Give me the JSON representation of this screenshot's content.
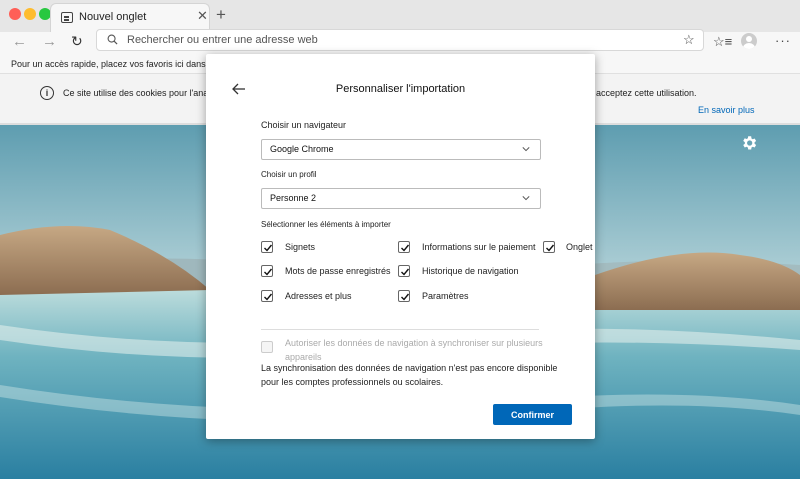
{
  "browser": {
    "tab_title": "Nouvel onglet",
    "address_placeholder": "Rechercher ou entrer une adresse web",
    "favorites_bar_text": "Pour un accès rapide, placez vos favoris ici dans la barre",
    "cookie_text_left": "Ce site utilise des cookies pour l'analy",
    "cookie_text_right": "acceptez cette utilisation.",
    "learn_more": "En savoir plus"
  },
  "dialog": {
    "title": "Personnaliser l'importation",
    "browser_label": "Choisir un navigateur",
    "browser_value": "Google Chrome",
    "profile_label": "Choisir un profil",
    "profile_value": "Personne 2",
    "items_label": "Sélectionner les éléments à importer",
    "items": [
      {
        "label": "Signets",
        "checked": true
      },
      {
        "label": "Informations sur le paiement",
        "checked": true
      },
      {
        "label": "Onglet",
        "checked": true
      },
      {
        "label": "Mots de passe enregistrés",
        "checked": true
      },
      {
        "label": "Historique de navigation",
        "checked": true
      },
      {
        "label": "Adresses et plus",
        "checked": true
      },
      {
        "label": "Paramètres",
        "checked": true
      }
    ],
    "sync_label": "Autoriser les données de navigation à synchroniser sur plusieurs appareils",
    "sync_note": "La synchronisation des données de navigation n'est pas encore disponible pour les comptes professionnels ou scolaires.",
    "confirm": "Confirmer"
  },
  "colors": {
    "accent": "#0067b8",
    "traffic_red": "#ff5f57",
    "traffic_yellow": "#febc2e",
    "traffic_green": "#28c840"
  }
}
